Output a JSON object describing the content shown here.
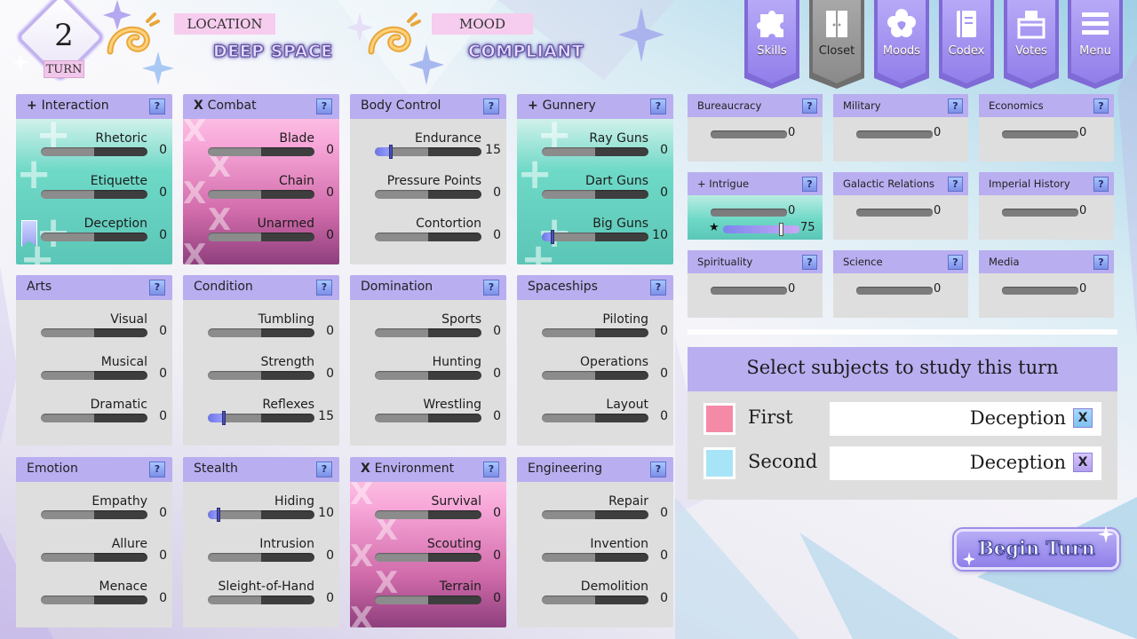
{
  "turn": {
    "number": "2",
    "label": "TURN"
  },
  "location": {
    "label": "LOCATION",
    "value": "DEEP SPACE"
  },
  "mood": {
    "label": "MOOD",
    "value": "COMPLIANT"
  },
  "nav": [
    {
      "label": "Skills",
      "icon": "puzzle-icon"
    },
    {
      "label": "Closet",
      "icon": "wardrobe-icon"
    },
    {
      "label": "Moods",
      "icon": "heart-flower-icon"
    },
    {
      "label": "Codex",
      "icon": "book-icon"
    },
    {
      "label": "Votes",
      "icon": "ballot-box-icon"
    },
    {
      "label": "Menu",
      "icon": "hamburger-icon"
    }
  ],
  "help_label": "?",
  "skill_panels": [
    {
      "title": "Interaction",
      "prefix": "+",
      "style": "teal",
      "skills": [
        {
          "name": "Rhetoric",
          "value": "0",
          "level": 0
        },
        {
          "name": "Etiquette",
          "value": "0",
          "level": 0
        },
        {
          "name": "Deception",
          "value": "0",
          "level": 0
        }
      ]
    },
    {
      "title": "Combat",
      "prefix": "X",
      "style": "pink",
      "skills": [
        {
          "name": "Blade",
          "value": "0",
          "level": 0
        },
        {
          "name": "Chain",
          "value": "0",
          "level": 0
        },
        {
          "name": "Unarmed",
          "value": "0",
          "level": 0
        }
      ]
    },
    {
      "title": "Body Control",
      "prefix": "",
      "style": "gray",
      "skills": [
        {
          "name": "Endurance",
          "value": "15",
          "level": 15
        },
        {
          "name": "Pressure Points",
          "value": "0",
          "level": 0
        },
        {
          "name": "Contortion",
          "value": "0",
          "level": 0
        }
      ]
    },
    {
      "title": "Gunnery",
      "prefix": "+",
      "style": "teal",
      "skills": [
        {
          "name": "Ray Guns",
          "value": "0",
          "level": 0
        },
        {
          "name": "Dart Guns",
          "value": "0",
          "level": 0
        },
        {
          "name": "Big Guns",
          "value": "10",
          "level": 10
        }
      ]
    },
    {
      "title": "Arts",
      "prefix": "",
      "style": "gray",
      "skills": [
        {
          "name": "Visual",
          "value": "0",
          "level": 0
        },
        {
          "name": "Musical",
          "value": "0",
          "level": 0
        },
        {
          "name": "Dramatic",
          "value": "0",
          "level": 0
        }
      ]
    },
    {
      "title": "Condition",
      "prefix": "",
      "style": "gray",
      "skills": [
        {
          "name": "Tumbling",
          "value": "0",
          "level": 0
        },
        {
          "name": "Strength",
          "value": "0",
          "level": 0
        },
        {
          "name": "Reflexes",
          "value": "15",
          "level": 15
        }
      ]
    },
    {
      "title": "Domination",
      "prefix": "",
      "style": "gray",
      "skills": [
        {
          "name": "Sports",
          "value": "0",
          "level": 0
        },
        {
          "name": "Hunting",
          "value": "0",
          "level": 0
        },
        {
          "name": "Wrestling",
          "value": "0",
          "level": 0
        }
      ]
    },
    {
      "title": "Spaceships",
      "prefix": "",
      "style": "gray",
      "skills": [
        {
          "name": "Piloting",
          "value": "0",
          "level": 0
        },
        {
          "name": "Operations",
          "value": "0",
          "level": 0
        },
        {
          "name": "Layout",
          "value": "0",
          "level": 0
        }
      ]
    },
    {
      "title": "Emotion",
      "prefix": "",
      "style": "gray",
      "skills": [
        {
          "name": "Empathy",
          "value": "0",
          "level": 0
        },
        {
          "name": "Allure",
          "value": "0",
          "level": 0
        },
        {
          "name": "Menace",
          "value": "0",
          "level": 0
        }
      ]
    },
    {
      "title": "Stealth",
      "prefix": "",
      "style": "gray",
      "skills": [
        {
          "name": "Hiding",
          "value": "10",
          "level": 10
        },
        {
          "name": "Intrusion",
          "value": "0",
          "level": 0
        },
        {
          "name": "Sleight-of-Hand",
          "value": "0",
          "level": 0
        }
      ]
    },
    {
      "title": "Environment",
      "prefix": "X",
      "style": "pink",
      "skills": [
        {
          "name": "Survival",
          "value": "0",
          "level": 0
        },
        {
          "name": "Scouting",
          "value": "0",
          "level": 0
        },
        {
          "name": "Terrain",
          "value": "0",
          "level": 0
        }
      ]
    },
    {
      "title": "Engineering",
      "prefix": "",
      "style": "gray",
      "skills": [
        {
          "name": "Repair",
          "value": "0",
          "level": 0
        },
        {
          "name": "Invention",
          "value": "0",
          "level": 0
        },
        {
          "name": "Demolition",
          "value": "0",
          "level": 0
        }
      ]
    }
  ],
  "knowledge": [
    {
      "title": "Bureaucracy",
      "prefix": "",
      "value": "0"
    },
    {
      "title": "Military",
      "prefix": "",
      "value": "0"
    },
    {
      "title": "Economics",
      "prefix": "",
      "value": "0"
    },
    {
      "title": "Intrigue",
      "prefix": "+",
      "value": "0",
      "secondary_value": "75",
      "star": "★"
    },
    {
      "title": "Galactic Relations",
      "prefix": "",
      "value": "0"
    },
    {
      "title": "Imperial History",
      "prefix": "",
      "value": "0"
    },
    {
      "title": "Spirituality",
      "prefix": "",
      "value": "0"
    },
    {
      "title": "Science",
      "prefix": "",
      "value": "0"
    },
    {
      "title": "Media",
      "prefix": "",
      "value": "0"
    }
  ],
  "study": {
    "title": "Select subjects to study this turn",
    "rows": [
      {
        "label": "First",
        "value": "Deception",
        "color": "#f58aa6",
        "clear": "X"
      },
      {
        "label": "Second",
        "value": "Deception",
        "color": "#a8e4f7",
        "clear": "X"
      }
    ]
  },
  "begin_turn": "Begin Turn",
  "colors": {
    "accent": "#b9aef0",
    "teal": "#6fd9c7",
    "pink": "#f7a6d8",
    "bar_fill": "#7c86ee"
  }
}
